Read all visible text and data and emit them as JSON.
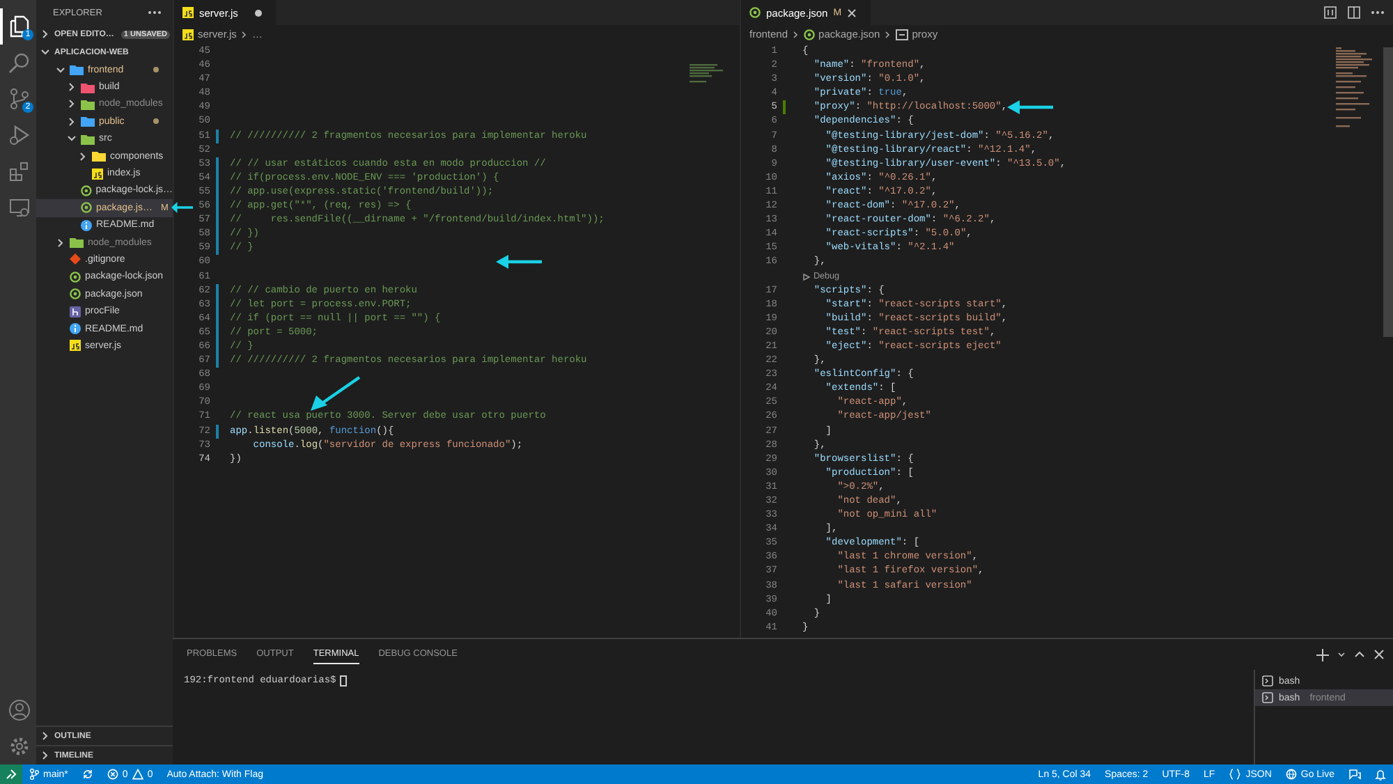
{
  "activity_bar": {
    "top": [
      {
        "kind": "files",
        "badge": "1",
        "selected": true
      },
      {
        "kind": "search",
        "selected": false
      },
      {
        "kind": "source-control",
        "badge": "2",
        "selected": false
      },
      {
        "kind": "run",
        "selected": false
      },
      {
        "kind": "extensions",
        "selected": false
      },
      {
        "kind": "remote",
        "selected": false
      }
    ],
    "bottom": [
      {
        "kind": "account"
      },
      {
        "kind": "settings"
      }
    ]
  },
  "sidebar": {
    "title": "EXPLORER",
    "sections": [
      {
        "label": "OPEN EDITO…",
        "badge": "1 UNSAVED",
        "expanded": false
      },
      {
        "label": "APLICACION-WEB",
        "expanded": true,
        "tree": [
          {
            "label": "frontend",
            "kind": "folder-blue",
            "expanded": true,
            "selected": false,
            "modified": true,
            "ignored": false,
            "children": [
              {
                "label": "build",
                "kind": "folder-red",
                "expanded": false,
                "selected": false,
                "modified": false,
                "ignored": false
              },
              {
                "label": "node_modules",
                "kind": "folder-green",
                "expanded": false,
                "selected": false,
                "modified": false,
                "ignored": true
              },
              {
                "label": "public",
                "kind": "folder-blue",
                "expanded": false,
                "selected": false,
                "modified": true,
                "ignored": false
              },
              {
                "label": "src",
                "kind": "folder-green",
                "expanded": true,
                "selected": false,
                "modified": false,
                "ignored": false,
                "children": [
                  {
                    "label": "components",
                    "kind": "folder-yellow",
                    "expanded": false,
                    "selected": false,
                    "modified": false,
                    "ignored": false
                  },
                  {
                    "label": "index.js",
                    "kind": "js",
                    "selected": false,
                    "modified": false,
                    "ignored": false
                  }
                ]
              },
              {
                "label": "package-lock.js…",
                "kind": "npm",
                "selected": false,
                "modified": false,
                "ignored": false
              },
              {
                "label": "package.js…",
                "kind": "npm",
                "selected": true,
                "modified": true,
                "ignored": false,
                "badge": "M",
                "pointer": {
                  "kind": "left"
                }
              },
              {
                "label": "README.md",
                "kind": "info",
                "selected": false,
                "modified": false,
                "ignored": false
              }
            ]
          },
          {
            "label": "node_modules",
            "kind": "folder-green",
            "expanded": false,
            "selected": false,
            "modified": false,
            "ignored": true
          },
          {
            "label": ".gitignore",
            "kind": "git",
            "selected": false,
            "modified": false,
            "ignored": false
          },
          {
            "label": "package-lock.json",
            "kind": "npm",
            "selected": false,
            "modified": false,
            "ignored": false
          },
          {
            "label": "package.json",
            "kind": "npm",
            "selected": false,
            "modified": false,
            "ignored": false
          },
          {
            "label": "procFile",
            "kind": "heroku",
            "selected": false,
            "modified": false,
            "ignored": false
          },
          {
            "label": "README.md",
            "kind": "info",
            "selected": false,
            "modified": false,
            "ignored": false
          },
          {
            "label": "server.js",
            "kind": "js",
            "selected": false,
            "modified": false,
            "ignored": false
          }
        ]
      }
    ],
    "bottom_sections": [
      {
        "label": "OUTLINE",
        "expanded": false
      },
      {
        "label": "TIMELINE",
        "expanded": false
      }
    ]
  },
  "editors": [
    {
      "tabs": [
        {
          "label": "server.js",
          "kind": "js",
          "dirty": true,
          "selected": true
        }
      ],
      "breadcrumb": [
        {
          "label": "server.js",
          "kind": "js"
        },
        {
          "label": "…"
        }
      ],
      "lines": [
        {
          "n": "45",
          "modified": false,
          "added": false,
          "current": false
        },
        {
          "n": "46",
          "modified": false,
          "added": false,
          "current": false
        },
        {
          "n": "47",
          "modified": false,
          "added": false,
          "current": false
        },
        {
          "n": "48",
          "modified": false,
          "added": false,
          "current": false
        },
        {
          "n": "49",
          "modified": false,
          "added": false,
          "current": false
        },
        {
          "n": "50",
          "modified": false,
          "added": false,
          "current": false
        },
        {
          "n": "51",
          "modified": true,
          "added": false,
          "current": false,
          "segs": [
            {
              "kind": "com",
              "text": "// ////////// 2 fragmentos necesarios para implementar heroku"
            }
          ]
        },
        {
          "n": "52",
          "modified": false,
          "added": false,
          "current": false
        },
        {
          "n": "53",
          "modified": true,
          "added": false,
          "current": false,
          "segs": [
            {
              "kind": "com",
              "text": "// // usar estáticos cuando esta en modo produccion //"
            }
          ]
        },
        {
          "n": "54",
          "modified": true,
          "added": false,
          "current": false,
          "segs": [
            {
              "kind": "com",
              "text": "// if(process.env.NODE_ENV === 'production') {"
            }
          ]
        },
        {
          "n": "55",
          "modified": true,
          "added": false,
          "current": false,
          "segs": [
            {
              "kind": "com",
              "text": "// app.use(express.static('frontend/build'));"
            }
          ]
        },
        {
          "n": "56",
          "modified": true,
          "added": false,
          "current": false,
          "segs": [
            {
              "kind": "com",
              "text": "// app.get(\"*\", (req, res) => {"
            }
          ]
        },
        {
          "n": "57",
          "modified": true,
          "added": false,
          "current": false,
          "segs": [
            {
              "kind": "com",
              "text": "//     res.sendFile((__dirname + \"/frontend/build/index.html\"));"
            }
          ]
        },
        {
          "n": "58",
          "modified": true,
          "added": false,
          "current": false,
          "segs": [
            {
              "kind": "com",
              "text": "// })"
            }
          ]
        },
        {
          "n": "59",
          "modified": true,
          "added": false,
          "current": false,
          "segs": [
            {
              "kind": "com",
              "text": "// }"
            }
          ]
        },
        {
          "n": "60",
          "modified": false,
          "added": false,
          "current": false,
          "pointer": {
            "kind": "left"
          }
        },
        {
          "n": "61",
          "modified": false,
          "added": false,
          "current": false
        },
        {
          "n": "62",
          "modified": true,
          "added": false,
          "current": false,
          "segs": [
            {
              "kind": "com",
              "text": "// // cambio de puerto en heroku"
            }
          ]
        },
        {
          "n": "63",
          "modified": true,
          "added": false,
          "current": false,
          "segs": [
            {
              "kind": "com",
              "text": "// let port = process.env.PORT;"
            }
          ]
        },
        {
          "n": "64",
          "modified": true,
          "added": false,
          "current": false,
          "segs": [
            {
              "kind": "com",
              "text": "// if (port == null || port == \"\") {"
            }
          ]
        },
        {
          "n": "65",
          "modified": true,
          "added": false,
          "current": false,
          "segs": [
            {
              "kind": "com",
              "text": "// port = 5000;"
            }
          ]
        },
        {
          "n": "66",
          "modified": true,
          "added": false,
          "current": false,
          "segs": [
            {
              "kind": "com",
              "text": "// }"
            }
          ]
        },
        {
          "n": "67",
          "modified": true,
          "added": false,
          "current": false,
          "segs": [
            {
              "kind": "com",
              "text": "// ////////// 2 fragmentos necesarios para implementar heroku"
            }
          ]
        },
        {
          "n": "68",
          "modified": false,
          "added": false,
          "current": false
        },
        {
          "n": "69",
          "modified": false,
          "added": false,
          "current": false
        },
        {
          "n": "70",
          "modified": false,
          "added": false,
          "current": false
        },
        {
          "n": "71",
          "modified": false,
          "added": false,
          "current": false,
          "pointer": {
            "kind": "down-left"
          },
          "segs": [
            {
              "kind": "com",
              "text": "// react usa puerto 3000. Server debe usar otro puerto"
            }
          ]
        },
        {
          "n": "72",
          "modified": true,
          "added": false,
          "current": false,
          "segs": [
            {
              "kind": "var",
              "text": "app"
            },
            {
              "kind": "p",
              "text": "."
            },
            {
              "kind": "fn",
              "text": "listen"
            },
            {
              "kind": "p",
              "text": "("
            },
            {
              "kind": "num",
              "text": "5000"
            },
            {
              "kind": "p",
              "text": ", "
            },
            {
              "kind": "kw",
              "text": "function"
            },
            {
              "kind": "p",
              "text": "(){"
            }
          ]
        },
        {
          "n": "73",
          "modified": false,
          "added": false,
          "current": false,
          "segs": [
            {
              "kind": "var",
              "text": "    console"
            },
            {
              "kind": "p",
              "text": "."
            },
            {
              "kind": "fn",
              "text": "log"
            },
            {
              "kind": "p",
              "text": "("
            },
            {
              "kind": "str",
              "text": "\"servidor de express funcionado\""
            },
            {
              "kind": "p",
              "text": ");"
            }
          ]
        },
        {
          "n": "74",
          "modified": false,
          "added": false,
          "current": true,
          "segs": [
            {
              "kind": "p",
              "text": "})"
            }
          ]
        }
      ]
    },
    {
      "tabs": [
        {
          "label": "package.json",
          "kind": "npm",
          "badge": "M",
          "dirty": false,
          "selected": true
        }
      ],
      "breadcrumb": [
        {
          "label": "frontend"
        },
        {
          "label": "package.json",
          "kind": "npm"
        },
        {
          "label": "proxy",
          "kind": "symbol"
        }
      ],
      "actions": [
        {
          "kind": "compare"
        },
        {
          "kind": "split"
        },
        {
          "kind": "more"
        }
      ],
      "lines": [
        {
          "n": "1",
          "modified": false,
          "added": false,
          "current": false,
          "segs": [
            {
              "kind": "p",
              "text": "{"
            }
          ]
        },
        {
          "n": "2",
          "modified": false,
          "added": false,
          "current": false,
          "segs": [
            {
              "kind": "key",
              "text": "  \"name\""
            },
            {
              "kind": "p",
              "text": ": "
            },
            {
              "kind": "str",
              "text": "\"frontend\""
            },
            {
              "kind": "p",
              "text": ","
            }
          ]
        },
        {
          "n": "3",
          "modified": false,
          "added": false,
          "current": false,
          "segs": [
            {
              "kind": "key",
              "text": "  \"version\""
            },
            {
              "kind": "p",
              "text": ": "
            },
            {
              "kind": "str",
              "text": "\"0.1.0\""
            },
            {
              "kind": "p",
              "text": ","
            }
          ]
        },
        {
          "n": "4",
          "modified": false,
          "added": false,
          "current": false,
          "segs": [
            {
              "kind": "key",
              "text": "  \"private\""
            },
            {
              "kind": "p",
              "text": ": "
            },
            {
              "kind": "kw",
              "text": "true"
            },
            {
              "kind": "p",
              "text": ","
            }
          ]
        },
        {
          "n": "5",
          "modified": false,
          "added": true,
          "current": true,
          "pointer": {
            "kind": "left"
          },
          "segs": [
            {
              "kind": "key",
              "text": "  \"proxy\""
            },
            {
              "kind": "p",
              "text": ": "
            },
            {
              "kind": "str",
              "text": "\"http://localhost:5000\""
            },
            {
              "kind": "p",
              "text": ","
            }
          ]
        },
        {
          "n": "6",
          "modified": false,
          "added": false,
          "current": false,
          "segs": [
            {
              "kind": "key",
              "text": "  \"dependencies\""
            },
            {
              "kind": "p",
              "text": ": {"
            }
          ]
        },
        {
          "n": "7",
          "modified": false,
          "added": false,
          "current": false,
          "segs": [
            {
              "kind": "key",
              "text": "    \"@testing-library/jest-dom\""
            },
            {
              "kind": "p",
              "text": ": "
            },
            {
              "kind": "str",
              "text": "\"^5.16.2\""
            },
            {
              "kind": "p",
              "text": ","
            }
          ]
        },
        {
          "n": "8",
          "modified": false,
          "added": false,
          "current": false,
          "segs": [
            {
              "kind": "key",
              "text": "    \"@testing-library/react\""
            },
            {
              "kind": "p",
              "text": ": "
            },
            {
              "kind": "str",
              "text": "\"^12.1.4\""
            },
            {
              "kind": "p",
              "text": ","
            }
          ]
        },
        {
          "n": "9",
          "modified": false,
          "added": false,
          "current": false,
          "segs": [
            {
              "kind": "key",
              "text": "    \"@testing-library/user-event\""
            },
            {
              "kind": "p",
              "text": ": "
            },
            {
              "kind": "str",
              "text": "\"^13.5.0\""
            },
            {
              "kind": "p",
              "text": ","
            }
          ]
        },
        {
          "n": "10",
          "modified": false,
          "added": false,
          "current": false,
          "segs": [
            {
              "kind": "key",
              "text": "    \"axios\""
            },
            {
              "kind": "p",
              "text": ": "
            },
            {
              "kind": "str",
              "text": "\"^0.26.1\""
            },
            {
              "kind": "p",
              "text": ","
            }
          ]
        },
        {
          "n": "11",
          "modified": false,
          "added": false,
          "current": false,
          "segs": [
            {
              "kind": "key",
              "text": "    \"react\""
            },
            {
              "kind": "p",
              "text": ": "
            },
            {
              "kind": "str",
              "text": "\"^17.0.2\""
            },
            {
              "kind": "p",
              "text": ","
            }
          ]
        },
        {
          "n": "12",
          "modified": false,
          "added": false,
          "current": false,
          "segs": [
            {
              "kind": "key",
              "text": "    \"react-dom\""
            },
            {
              "kind": "p",
              "text": ": "
            },
            {
              "kind": "str",
              "text": "\"^17.0.2\""
            },
            {
              "kind": "p",
              "text": ","
            }
          ]
        },
        {
          "n": "13",
          "modified": false,
          "added": false,
          "current": false,
          "segs": [
            {
              "kind": "key",
              "text": "    \"react-router-dom\""
            },
            {
              "kind": "p",
              "text": ": "
            },
            {
              "kind": "str",
              "text": "\"^6.2.2\""
            },
            {
              "kind": "p",
              "text": ","
            }
          ]
        },
        {
          "n": "14",
          "modified": false,
          "added": false,
          "current": false,
          "segs": [
            {
              "kind": "key",
              "text": "    \"react-scripts\""
            },
            {
              "kind": "p",
              "text": ": "
            },
            {
              "kind": "str",
              "text": "\"5.0.0\""
            },
            {
              "kind": "p",
              "text": ","
            }
          ]
        },
        {
          "n": "15",
          "modified": false,
          "added": false,
          "current": false,
          "segs": [
            {
              "kind": "key",
              "text": "    \"web-vitals\""
            },
            {
              "kind": "p",
              "text": ": "
            },
            {
              "kind": "str",
              "text": "\"^2.1.4\""
            }
          ]
        },
        {
          "n": "16",
          "modified": false,
          "added": false,
          "current": false,
          "segs": [
            {
              "kind": "p",
              "text": "  },"
            }
          ]
        },
        {
          "kind": "codelens",
          "text": "Debug"
        },
        {
          "n": "17",
          "modified": false,
          "added": false,
          "current": false,
          "segs": [
            {
              "kind": "key",
              "text": "  \"scripts\""
            },
            {
              "kind": "p",
              "text": ": {"
            }
          ]
        },
        {
          "n": "18",
          "modified": false,
          "added": false,
          "current": false,
          "segs": [
            {
              "kind": "key",
              "text": "    \"start\""
            },
            {
              "kind": "p",
              "text": ": "
            },
            {
              "kind": "str",
              "text": "\"react-scripts start\""
            },
            {
              "kind": "p",
              "text": ","
            }
          ]
        },
        {
          "n": "19",
          "modified": false,
          "added": false,
          "current": false,
          "segs": [
            {
              "kind": "key",
              "text": "    \"build\""
            },
            {
              "kind": "p",
              "text": ": "
            },
            {
              "kind": "str",
              "text": "\"react-scripts build\""
            },
            {
              "kind": "p",
              "text": ","
            }
          ]
        },
        {
          "n": "20",
          "modified": false,
          "added": false,
          "current": false,
          "segs": [
            {
              "kind": "key",
              "text": "    \"test\""
            },
            {
              "kind": "p",
              "text": ": "
            },
            {
              "kind": "str",
              "text": "\"react-scripts test\""
            },
            {
              "kind": "p",
              "text": ","
            }
          ]
        },
        {
          "n": "21",
          "modified": false,
          "added": false,
          "current": false,
          "segs": [
            {
              "kind": "key",
              "text": "    \"eject\""
            },
            {
              "kind": "p",
              "text": ": "
            },
            {
              "kind": "str",
              "text": "\"react-scripts eject\""
            }
          ]
        },
        {
          "n": "22",
          "modified": false,
          "added": false,
          "current": false,
          "segs": [
            {
              "kind": "p",
              "text": "  },"
            }
          ]
        },
        {
          "n": "23",
          "modified": false,
          "added": false,
          "current": false,
          "segs": [
            {
              "kind": "key",
              "text": "  \"eslintConfig\""
            },
            {
              "kind": "p",
              "text": ": {"
            }
          ]
        },
        {
          "n": "24",
          "modified": false,
          "added": false,
          "current": false,
          "segs": [
            {
              "kind": "key",
              "text": "    \"extends\""
            },
            {
              "kind": "p",
              "text": ": ["
            }
          ]
        },
        {
          "n": "25",
          "modified": false,
          "added": false,
          "current": false,
          "segs": [
            {
              "kind": "str",
              "text": "      \"react-app\""
            },
            {
              "kind": "p",
              "text": ","
            }
          ]
        },
        {
          "n": "26",
          "modified": false,
          "added": false,
          "current": false,
          "segs": [
            {
              "kind": "str",
              "text": "      \"react-app/jest\""
            }
          ]
        },
        {
          "n": "27",
          "modified": false,
          "added": false,
          "current": false,
          "segs": [
            {
              "kind": "p",
              "text": "    ]"
            }
          ]
        },
        {
          "n": "28",
          "modified": false,
          "added": false,
          "current": false,
          "segs": [
            {
              "kind": "p",
              "text": "  },"
            }
          ]
        },
        {
          "n": "29",
          "modified": false,
          "added": false,
          "current": false,
          "segs": [
            {
              "kind": "key",
              "text": "  \"browserslist\""
            },
            {
              "kind": "p",
              "text": ": {"
            }
          ]
        },
        {
          "n": "30",
          "modified": false,
          "added": false,
          "current": false,
          "segs": [
            {
              "kind": "key",
              "text": "    \"production\""
            },
            {
              "kind": "p",
              "text": ": ["
            }
          ]
        },
        {
          "n": "31",
          "modified": false,
          "added": false,
          "current": false,
          "segs": [
            {
              "kind": "str",
              "text": "      \">0.2%\""
            },
            {
              "kind": "p",
              "text": ","
            }
          ]
        },
        {
          "n": "32",
          "modified": false,
          "added": false,
          "current": false,
          "segs": [
            {
              "kind": "str",
              "text": "      \"not dead\""
            },
            {
              "kind": "p",
              "text": ","
            }
          ]
        },
        {
          "n": "33",
          "modified": false,
          "added": false,
          "current": false,
          "segs": [
            {
              "kind": "str",
              "text": "      \"not op_mini all\""
            }
          ]
        },
        {
          "n": "34",
          "modified": false,
          "added": false,
          "current": false,
          "segs": [
            {
              "kind": "p",
              "text": "    ],"
            }
          ]
        },
        {
          "n": "35",
          "modified": false,
          "added": false,
          "current": false,
          "segs": [
            {
              "kind": "key",
              "text": "    \"development\""
            },
            {
              "kind": "p",
              "text": ": ["
            }
          ]
        },
        {
          "n": "36",
          "modified": false,
          "added": false,
          "current": false,
          "segs": [
            {
              "kind": "str",
              "text": "      \"last 1 chrome version\""
            },
            {
              "kind": "p",
              "text": ","
            }
          ]
        },
        {
          "n": "37",
          "modified": false,
          "added": false,
          "current": false,
          "segs": [
            {
              "kind": "str",
              "text": "      \"last 1 firefox version\""
            },
            {
              "kind": "p",
              "text": ","
            }
          ]
        },
        {
          "n": "38",
          "modified": false,
          "added": false,
          "current": false,
          "segs": [
            {
              "kind": "str",
              "text": "      \"last 1 safari version\""
            }
          ]
        },
        {
          "n": "39",
          "modified": false,
          "added": false,
          "current": false,
          "segs": [
            {
              "kind": "p",
              "text": "    ]"
            }
          ]
        },
        {
          "n": "40",
          "modified": false,
          "added": false,
          "current": false,
          "segs": [
            {
              "kind": "p",
              "text": "  }"
            }
          ]
        },
        {
          "n": "41",
          "modified": false,
          "added": false,
          "current": false,
          "segs": [
            {
              "kind": "p",
              "text": "}"
            }
          ]
        }
      ]
    }
  ],
  "panel": {
    "tabs": [
      {
        "label": "PROBLEMS",
        "selected": false
      },
      {
        "label": "OUTPUT",
        "selected": false
      },
      {
        "label": "TERMINAL",
        "selected": true
      },
      {
        "label": "DEBUG CONSOLE",
        "selected": false
      }
    ],
    "actions": [
      {
        "kind": "plus"
      },
      {
        "kind": "chevron-down"
      },
      {
        "kind": "chevron-up"
      },
      {
        "kind": "close"
      }
    ],
    "terminal": {
      "prompt": "192:frontend eduardoarias$"
    },
    "terminals": [
      {
        "label": "bash",
        "selected": false
      },
      {
        "label": "bash",
        "detail": "frontend",
        "selected": true
      }
    ]
  },
  "status_bar": {
    "left": [
      {
        "kind": "remote"
      },
      {
        "kind": "branch",
        "text": "main*"
      },
      {
        "kind": "sync"
      },
      {
        "kind": "problems",
        "errors": "0",
        "warnings": "0"
      },
      {
        "kind": "text",
        "text": "Auto Attach: With Flag"
      }
    ],
    "right": [
      {
        "kind": "text",
        "text": "Ln 5, Col 34"
      },
      {
        "kind": "text",
        "text": "Spaces: 2"
      },
      {
        "kind": "text",
        "text": "UTF-8"
      },
      {
        "kind": "text",
        "text": "LF"
      },
      {
        "kind": "language",
        "text": "JSON"
      },
      {
        "kind": "golive",
        "text": "Go Live"
      },
      {
        "kind": "feedback"
      },
      {
        "kind": "bell"
      }
    ]
  }
}
